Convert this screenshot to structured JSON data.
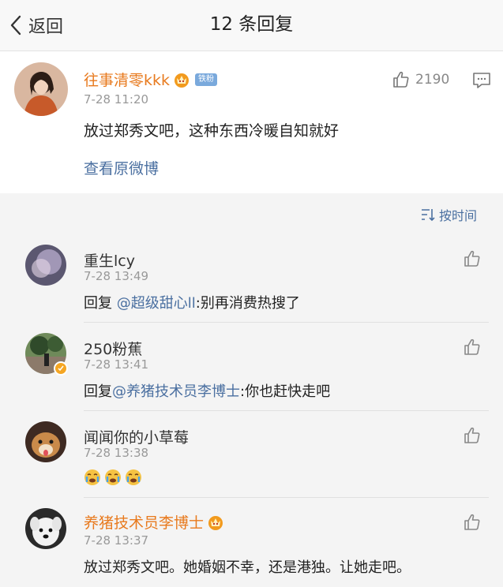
{
  "nav": {
    "back_label": "返回",
    "title": "12 条回复"
  },
  "main_post": {
    "username": "往事清零kkk",
    "fans_badge": "铁粉",
    "time": "7-28 11:20",
    "content": "放过郑秀文吧，这种东西冷暖自知就好",
    "likes": "2190",
    "view_original": "查看原微博"
  },
  "sort": {
    "label": "按时间"
  },
  "replies": [
    {
      "username": "重生lcy",
      "time": "7-28 13:49",
      "prefix": "回复 ",
      "mention": "@超级甜心ll",
      "text": ":别再消费热搜了"
    },
    {
      "username": "250粉蕉",
      "time": "7-28 13:41",
      "prefix": "回复",
      "mention": "@养猪技术员李博士",
      "text": ":你也赶快走吧"
    },
    {
      "username": "闻闻你的小草莓",
      "time": "7-28 13:38",
      "emoji": [
        "crying-face",
        "crying-face",
        "crying-face"
      ]
    },
    {
      "username": "养猪技术员李博士",
      "time": "7-28 13:37",
      "text": "放过郑秀文吧。她婚姻不幸，还是港独。让她走吧。"
    }
  ],
  "colors": {
    "accent_orange": "#e87a1e",
    "link_blue": "#4a6fa0",
    "background": "#f4f4f4"
  }
}
